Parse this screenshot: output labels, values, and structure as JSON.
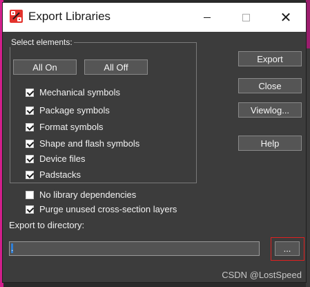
{
  "window": {
    "title": "Export Libraries",
    "close_glyph": "✕"
  },
  "select_elements": {
    "label": "Select elements:",
    "all_on": "All On",
    "all_off": "All Off",
    "items": [
      {
        "label": "Mechanical symbols",
        "checked": true
      },
      {
        "label": "Package symbols",
        "checked": true
      },
      {
        "label": "Format symbols",
        "checked": true
      },
      {
        "label": "Shape and flash symbols",
        "checked": true
      },
      {
        "label": "Device files",
        "checked": true
      },
      {
        "label": "Padstacks",
        "checked": true
      }
    ]
  },
  "options": [
    {
      "label": "No library dependencies",
      "checked": false
    },
    {
      "label": "Purge unused cross-section layers",
      "checked": true
    }
  ],
  "actions": {
    "export": "Export",
    "close": "Close",
    "viewlog": "Viewlog...",
    "help": "Help"
  },
  "directory": {
    "label": "Export to directory:",
    "value": ".",
    "browse": "..."
  },
  "watermark": "CSDN @LostSpeed",
  "colors": {
    "dialog_bg": "#3c3c3c",
    "button_bg": "#555555",
    "highlight": "#e02020"
  }
}
